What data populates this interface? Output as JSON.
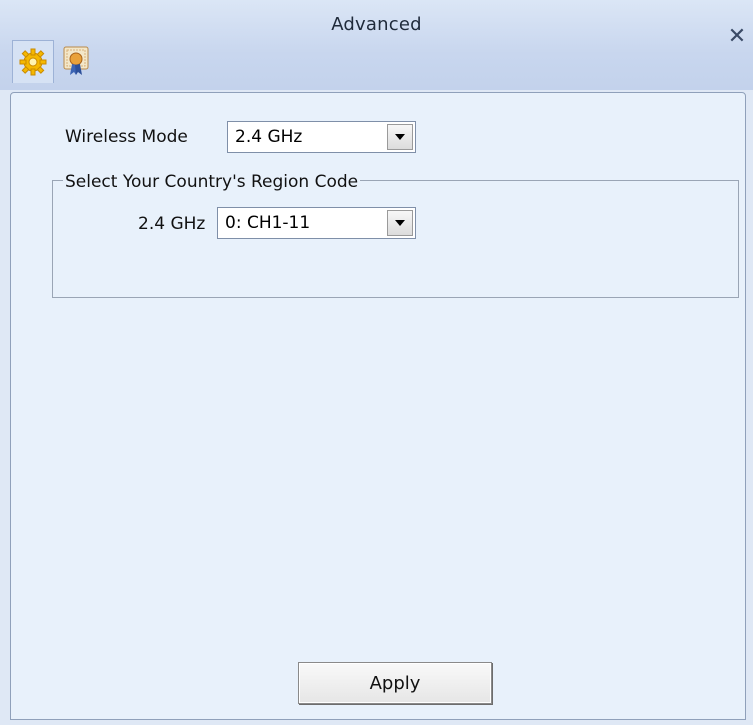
{
  "window": {
    "title": "Advanced",
    "close_glyph": "✕"
  },
  "tabs": [
    {
      "icon": "gear-icon",
      "selected": true
    },
    {
      "icon": "certificate-icon",
      "selected": false
    }
  ],
  "wireless_mode": {
    "label": "Wireless Mode",
    "value": "2.4 GHz"
  },
  "region": {
    "group_label": "Select Your Country's Region Code",
    "band_label": "2.4 GHz",
    "value": "0: CH1-11"
  },
  "actions": {
    "apply_label": "Apply"
  },
  "colors": {
    "titlebar": "#c8d6ee",
    "panel": "#e8f1fb",
    "gear": "#f5b800"
  }
}
